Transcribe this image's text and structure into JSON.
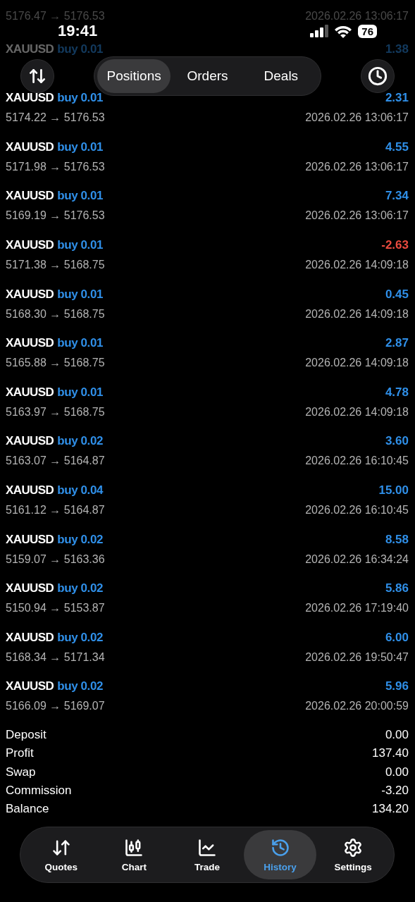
{
  "status_bar": {
    "time": "19:41",
    "battery": "76"
  },
  "toolbar": {
    "tabs": [
      {
        "label": "Positions",
        "selected": true
      },
      {
        "label": "Orders",
        "selected": false
      },
      {
        "label": "Deals",
        "selected": false
      }
    ]
  },
  "deals": [
    {
      "dimmed": true,
      "prices": "5176.47 → 5176.53",
      "time": "2026.02.26 13:06:17"
    },
    {
      "dimmed": true,
      "symbol": "XAUUSD",
      "side": "buy 0.01",
      "profit": "1.38",
      "negative": false
    },
    {
      "dimmed": false,
      "symbol": "XAUUSD",
      "side": "buy 0.01",
      "profit": "2.31",
      "negative": false,
      "prices": "5174.22 → 5176.53",
      "time": "2026.02.26 13:06:17"
    },
    {
      "dimmed": false,
      "symbol": "XAUUSD",
      "side": "buy 0.01",
      "profit": "4.55",
      "negative": false,
      "prices": "5171.98 → 5176.53",
      "time": "2026.02.26 13:06:17"
    },
    {
      "dimmed": false,
      "symbol": "XAUUSD",
      "side": "buy 0.01",
      "profit": "7.34",
      "negative": false,
      "prices": "5169.19 → 5176.53",
      "time": "2026.02.26 13:06:17"
    },
    {
      "dimmed": false,
      "symbol": "XAUUSD",
      "side": "buy 0.01",
      "profit": "-2.63",
      "negative": true,
      "prices": "5171.38 → 5168.75",
      "time": "2026.02.26 14:09:18"
    },
    {
      "dimmed": false,
      "symbol": "XAUUSD",
      "side": "buy 0.01",
      "profit": "0.45",
      "negative": false,
      "prices": "5168.30 → 5168.75",
      "time": "2026.02.26 14:09:18"
    },
    {
      "dimmed": false,
      "symbol": "XAUUSD",
      "side": "buy 0.01",
      "profit": "2.87",
      "negative": false,
      "prices": "5165.88 → 5168.75",
      "time": "2026.02.26 14:09:18"
    },
    {
      "dimmed": false,
      "symbol": "XAUUSD",
      "side": "buy 0.01",
      "profit": "4.78",
      "negative": false,
      "prices": "5163.97 → 5168.75",
      "time": "2026.02.26 14:09:18"
    },
    {
      "dimmed": false,
      "symbol": "XAUUSD",
      "side": "buy 0.02",
      "profit": "3.60",
      "negative": false,
      "prices": "5163.07 → 5164.87",
      "time": "2026.02.26 16:10:45"
    },
    {
      "dimmed": false,
      "symbol": "XAUUSD",
      "side": "buy 0.04",
      "profit": "15.00",
      "negative": false,
      "prices": "5161.12 → 5164.87",
      "time": "2026.02.26 16:10:45"
    },
    {
      "dimmed": false,
      "symbol": "XAUUSD",
      "side": "buy 0.02",
      "profit": "8.58",
      "negative": false,
      "prices": "5159.07 → 5163.36",
      "time": "2026.02.26 16:34:24"
    },
    {
      "dimmed": false,
      "symbol": "XAUUSD",
      "side": "buy 0.02",
      "profit": "5.86",
      "negative": false,
      "prices": "5150.94 → 5153.87",
      "time": "2026.02.26 17:19:40"
    },
    {
      "dimmed": false,
      "symbol": "XAUUSD",
      "side": "buy 0.02",
      "profit": "6.00",
      "negative": false,
      "prices": "5168.34 → 5171.34",
      "time": "2026.02.26 19:50:47"
    },
    {
      "dimmed": false,
      "symbol": "XAUUSD",
      "side": "buy 0.02",
      "profit": "5.96",
      "negative": false,
      "prices": "5166.09 → 5169.07",
      "time": "2026.02.26 20:00:59"
    }
  ],
  "summary": [
    {
      "label": "Deposit",
      "value": "0.00"
    },
    {
      "label": "Profit",
      "value": "137.40"
    },
    {
      "label": "Swap",
      "value": "0.00"
    },
    {
      "label": "Commission",
      "value": "-3.20"
    },
    {
      "label": "Balance",
      "value": "134.20"
    }
  ],
  "nav": [
    {
      "label": "Quotes",
      "selected": false
    },
    {
      "label": "Chart",
      "selected": false
    },
    {
      "label": "Trade",
      "selected": false
    },
    {
      "label": "History",
      "selected": true
    },
    {
      "label": "Settings",
      "selected": false
    }
  ]
}
